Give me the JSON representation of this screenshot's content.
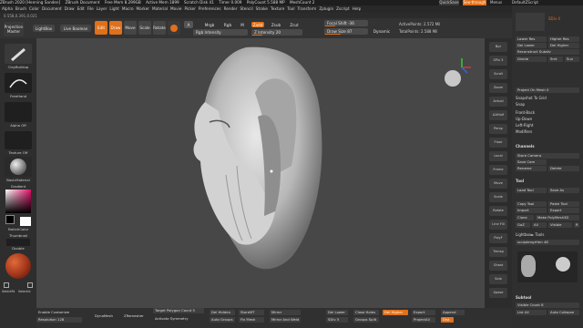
{
  "titlebar": {
    "app": "ZBrush 2020 [Henning Sanden]",
    "doc": "ZBrush Document",
    "free_mem": "Free Mem 8.299GB",
    "active_mem": "Active Mem 1899",
    "scratch": "Scratch Disk 41",
    "timer": "Timer 0.009",
    "polycount": "PolyCount 5.588 MP",
    "meshcount": "MeshCount 2",
    "quicksave": "QuickSave",
    "see_through": "See-through 0",
    "menus_label": "Menus",
    "ui_label": "DefaultZScript"
  },
  "menubar": [
    "Alpha",
    "Brush",
    "Color",
    "Document",
    "Draw",
    "Edit",
    "File",
    "Layer",
    "Light",
    "Macro",
    "Marker",
    "Material",
    "Movie",
    "Picker",
    "Preferences",
    "Render",
    "Stencil",
    "Stroke",
    "Texture",
    "Tool",
    "Transform",
    "Zplugin",
    "Zscript",
    "Help"
  ],
  "coords": "0.558,0.391,0.021",
  "toolbar": {
    "projection_master": "Projection Master",
    "lightbox": "LightBox",
    "live_boolean": "Live Boolean",
    "edit": "Edit",
    "draw": "Draw",
    "move": "Move",
    "scale": "Scale",
    "rotate": "Rotate",
    "mrgb": "Mrgb",
    "rgb": "Rgb",
    "m": "M",
    "zadd": "Zadd",
    "zsub": "Zsub",
    "zcut": "Zcut",
    "rgb_intensity": "Rgb Intensity",
    "z_intensity": "Z Intensity 20",
    "focal_shift": "Focal Shift -36",
    "draw_size": "Draw Size 87",
    "dynamic": "Dynamic",
    "active_points": "ActivePoints: 2.572 Mil",
    "total_points": "TotalPoints: 2.588 Mil"
  },
  "leftpanel": {
    "brush": "ClayBuildup",
    "stroke": "FreeHand",
    "alpha": "Alpha Off",
    "texture": "Texture Off",
    "material": "BasicMaterial",
    "gradient": "Gradient",
    "switch_color": "SwitchColor",
    "thumbnail": "Thumbnail",
    "double": "Double",
    "selectrt": "SelectRt",
    "selectlt": "SelectLt"
  },
  "rightstrip": [
    "Bpr",
    "SPix 3",
    "Scroll",
    "Zoom",
    "Actual",
    "AAHalf",
    "Persp",
    "Floor",
    "Local",
    "Frame",
    "Move",
    "Scale",
    "Rotate",
    "Line Fill",
    "PolyF",
    "Transp",
    "Ghost",
    "Solo",
    "Xpose"
  ],
  "rightpanel": {
    "load_tool": "Load Tool",
    "save_as": "Save As",
    "copy_tool": "Copy Tool",
    "paste_tool": "Paste Tool",
    "import": "Import",
    "export": "Export",
    "clone": "Clone",
    "make_polymesh": "Make PolyMesh3D",
    "goz": "GoZ",
    "all": "All",
    "visible": "Visible",
    "r": "R",
    "lightbox_tools": "Lightbox► Tools",
    "sculptengine": "sculptengrHen 48",
    "subtool": "Subtool",
    "visible_count": "Visible Count 8",
    "list_all": "List All",
    "auto_collapse": "Auto Collapse",
    "tool_header": "Tool",
    "channels": "Channels",
    "store_camera": "Store Camera",
    "save_cam": "Save Cam",
    "rename": "Rename",
    "delete": "Delete",
    "undo_history": "Undo History",
    "sdiv": "SDiv 4",
    "smt": "Smt",
    "lower_res": "Lower Res",
    "higher_res": "Higher Res",
    "del_lower": "Del Lower",
    "del_higher": "Del Higher",
    "reconstruct": "Reconstruct Subdiv",
    "divide": "Divide",
    "suv": "Suv",
    "project_on_mesh": "Project On Mesh 0",
    "snapshot": "Snapshot To Grid",
    "snap": "Snap",
    "front_back": "Front-Back",
    "up_down": "Up-Down",
    "left_right": "Left-Right",
    "modifiers": "Modifiers",
    "uvp": "Uvp",
    "smooth_mode": "Smooth Mode"
  },
  "bottombar": {
    "enable_customize": "Enable Customize",
    "resolution": "Resolution 128",
    "dynamesh": "DynaMesh",
    "zremesher": "ZRemesher",
    "target_polygons": "Target Polygon Count 5",
    "activate_symmetry": "Activate Symmetry",
    "del_hidden": "Del Hidden",
    "auto_groups": "Auto Groups",
    "storemt": "StoreMT",
    "fix_mesh": "Fix Mesh",
    "mirror": "Mirror",
    "mirror_weld": "Mirror And Weld",
    "del_lower": "Del Lower",
    "sdiv": "SDiv 5",
    "close_holes": "Close Holes",
    "groups_split": "Groups Split",
    "del_higher": "Del Higher",
    "export": "Export",
    "projectall": "ProjectAll",
    "append": "Append",
    "dist": "Dist"
  },
  "colors": {
    "accent": "#e0701a",
    "bg": "#2b2b2b",
    "viewport": "#474747"
  }
}
